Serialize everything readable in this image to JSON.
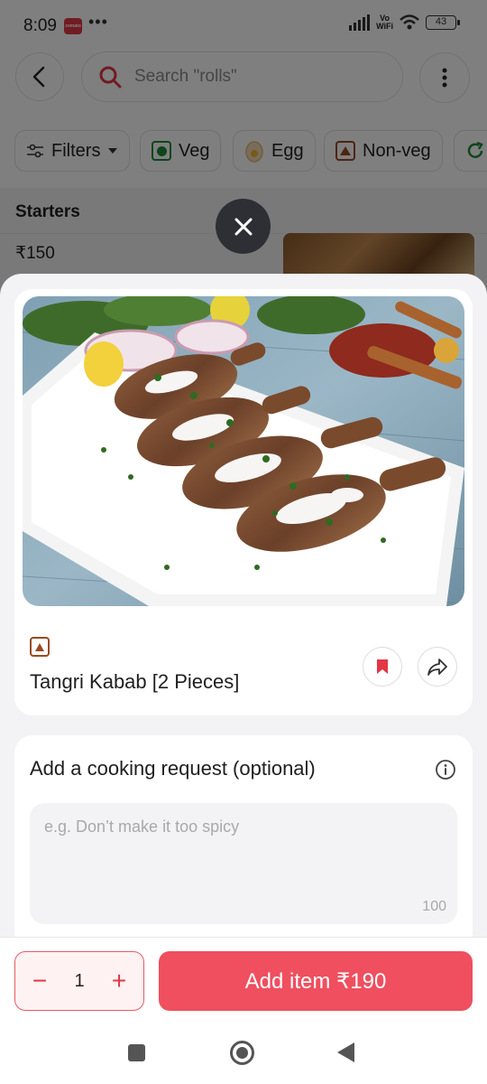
{
  "status_bar": {
    "time": "8:09",
    "app_badge": "zomato",
    "more": "•••",
    "network": "Vo WiFi",
    "battery": "43"
  },
  "header": {
    "search_placeholder": "Search \"rolls\""
  },
  "filters": {
    "chips": [
      "Filters",
      "Veg",
      "Egg",
      "Non-veg"
    ]
  },
  "menu": {
    "section_title": "Starters",
    "first_item_price": "₹150"
  },
  "item": {
    "name": "Tangri Kabab [2 Pieces]",
    "diet_type": "non-veg",
    "image_description": "grilled chicken drumsticks with cream and coriander"
  },
  "cooking_request": {
    "title": "Add a cooking request (optional)",
    "placeholder": "e.g. Don’t make it too spicy",
    "char_limit": "100"
  },
  "cart": {
    "quantity": "1",
    "add_label": "Add item ₹190"
  },
  "colors": {
    "brand": "#ef4f5f",
    "veg": "#1f8a3b",
    "nonveg": "#9a4a21"
  }
}
